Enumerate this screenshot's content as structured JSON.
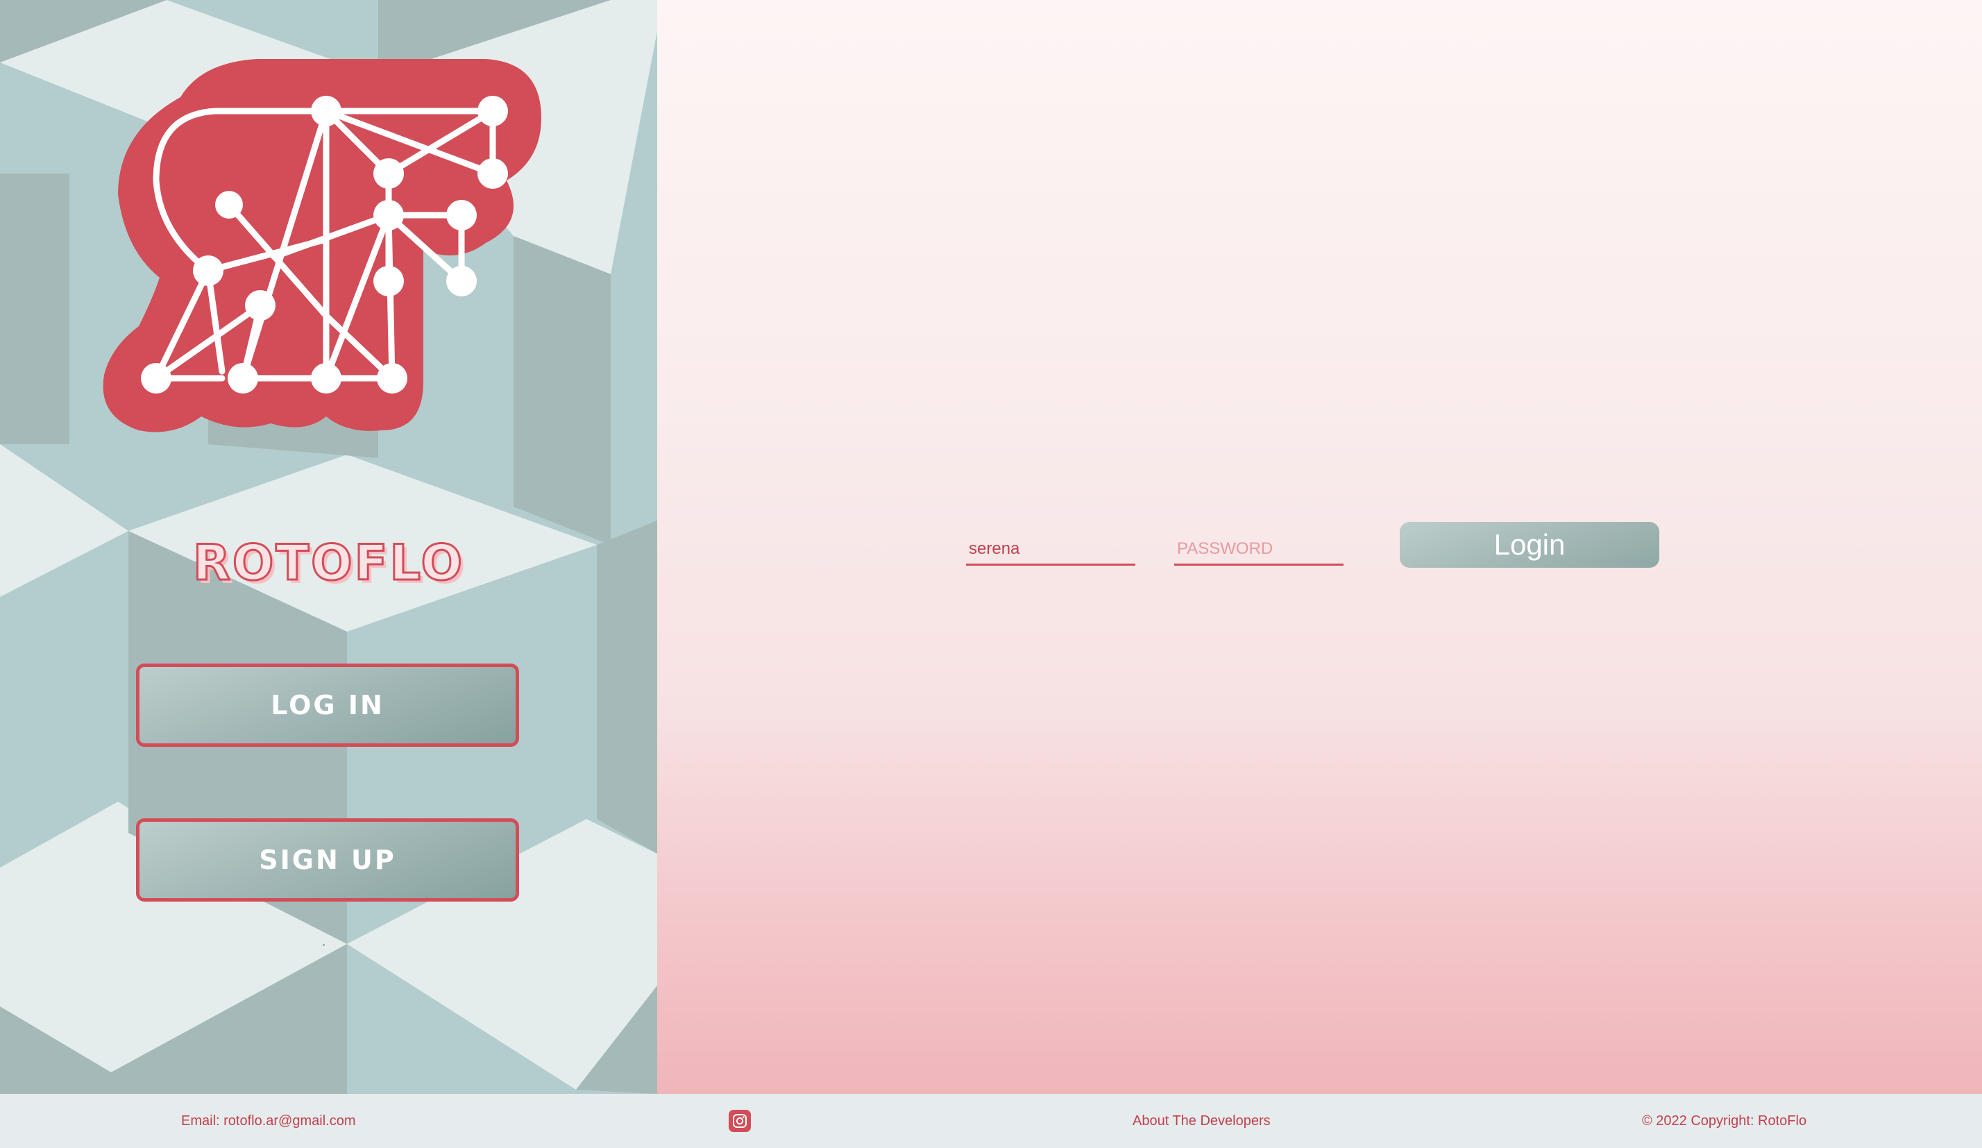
{
  "brand": {
    "name": "ROTOFLO"
  },
  "sidebar": {
    "login_label": "LOG IN",
    "signup_label": "SIGN UP"
  },
  "login_form": {
    "username_value": "serena",
    "password_placeholder": "PASSWORD",
    "submit_label": "Login"
  },
  "footer": {
    "email_text": "Email: rotoflo.ar@gmail.com",
    "instagram_icon": "instagram-icon",
    "about_label": "About The Developers",
    "copyright_text": "© 2022 Copyright: RotoFlo"
  },
  "colors": {
    "brand_red": "#d24d58",
    "cube_light": "#e4edec",
    "cube_mid": "#b3cdce",
    "cube_dark": "#a5bab8",
    "button_gray": "#9fb5b3",
    "footer_bg": "#e6eced"
  }
}
